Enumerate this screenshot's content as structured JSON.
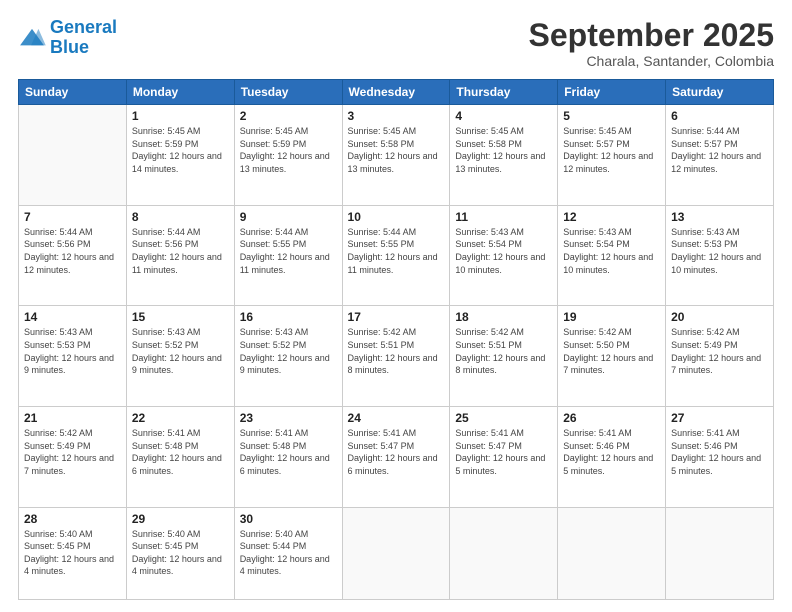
{
  "logo": {
    "line1": "General",
    "line2": "Blue"
  },
  "title": "September 2025",
  "subtitle": "Charala, Santander, Colombia",
  "days_of_week": [
    "Sunday",
    "Monday",
    "Tuesday",
    "Wednesday",
    "Thursday",
    "Friday",
    "Saturday"
  ],
  "weeks": [
    [
      {
        "num": "",
        "info": ""
      },
      {
        "num": "1",
        "info": "Sunrise: 5:45 AM\nSunset: 5:59 PM\nDaylight: 12 hours\nand 14 minutes."
      },
      {
        "num": "2",
        "info": "Sunrise: 5:45 AM\nSunset: 5:59 PM\nDaylight: 12 hours\nand 13 minutes."
      },
      {
        "num": "3",
        "info": "Sunrise: 5:45 AM\nSunset: 5:58 PM\nDaylight: 12 hours\nand 13 minutes."
      },
      {
        "num": "4",
        "info": "Sunrise: 5:45 AM\nSunset: 5:58 PM\nDaylight: 12 hours\nand 13 minutes."
      },
      {
        "num": "5",
        "info": "Sunrise: 5:45 AM\nSunset: 5:57 PM\nDaylight: 12 hours\nand 12 minutes."
      },
      {
        "num": "6",
        "info": "Sunrise: 5:44 AM\nSunset: 5:57 PM\nDaylight: 12 hours\nand 12 minutes."
      }
    ],
    [
      {
        "num": "7",
        "info": "Sunrise: 5:44 AM\nSunset: 5:56 PM\nDaylight: 12 hours\nand 12 minutes."
      },
      {
        "num": "8",
        "info": "Sunrise: 5:44 AM\nSunset: 5:56 PM\nDaylight: 12 hours\nand 11 minutes."
      },
      {
        "num": "9",
        "info": "Sunrise: 5:44 AM\nSunset: 5:55 PM\nDaylight: 12 hours\nand 11 minutes."
      },
      {
        "num": "10",
        "info": "Sunrise: 5:44 AM\nSunset: 5:55 PM\nDaylight: 12 hours\nand 11 minutes."
      },
      {
        "num": "11",
        "info": "Sunrise: 5:43 AM\nSunset: 5:54 PM\nDaylight: 12 hours\nand 10 minutes."
      },
      {
        "num": "12",
        "info": "Sunrise: 5:43 AM\nSunset: 5:54 PM\nDaylight: 12 hours\nand 10 minutes."
      },
      {
        "num": "13",
        "info": "Sunrise: 5:43 AM\nSunset: 5:53 PM\nDaylight: 12 hours\nand 10 minutes."
      }
    ],
    [
      {
        "num": "14",
        "info": "Sunrise: 5:43 AM\nSunset: 5:53 PM\nDaylight: 12 hours\nand 9 minutes."
      },
      {
        "num": "15",
        "info": "Sunrise: 5:43 AM\nSunset: 5:52 PM\nDaylight: 12 hours\nand 9 minutes."
      },
      {
        "num": "16",
        "info": "Sunrise: 5:43 AM\nSunset: 5:52 PM\nDaylight: 12 hours\nand 9 minutes."
      },
      {
        "num": "17",
        "info": "Sunrise: 5:42 AM\nSunset: 5:51 PM\nDaylight: 12 hours\nand 8 minutes."
      },
      {
        "num": "18",
        "info": "Sunrise: 5:42 AM\nSunset: 5:51 PM\nDaylight: 12 hours\nand 8 minutes."
      },
      {
        "num": "19",
        "info": "Sunrise: 5:42 AM\nSunset: 5:50 PM\nDaylight: 12 hours\nand 7 minutes."
      },
      {
        "num": "20",
        "info": "Sunrise: 5:42 AM\nSunset: 5:49 PM\nDaylight: 12 hours\nand 7 minutes."
      }
    ],
    [
      {
        "num": "21",
        "info": "Sunrise: 5:42 AM\nSunset: 5:49 PM\nDaylight: 12 hours\nand 7 minutes."
      },
      {
        "num": "22",
        "info": "Sunrise: 5:41 AM\nSunset: 5:48 PM\nDaylight: 12 hours\nand 6 minutes."
      },
      {
        "num": "23",
        "info": "Sunrise: 5:41 AM\nSunset: 5:48 PM\nDaylight: 12 hours\nand 6 minutes."
      },
      {
        "num": "24",
        "info": "Sunrise: 5:41 AM\nSunset: 5:47 PM\nDaylight: 12 hours\nand 6 minutes."
      },
      {
        "num": "25",
        "info": "Sunrise: 5:41 AM\nSunset: 5:47 PM\nDaylight: 12 hours\nand 5 minutes."
      },
      {
        "num": "26",
        "info": "Sunrise: 5:41 AM\nSunset: 5:46 PM\nDaylight: 12 hours\nand 5 minutes."
      },
      {
        "num": "27",
        "info": "Sunrise: 5:41 AM\nSunset: 5:46 PM\nDaylight: 12 hours\nand 5 minutes."
      }
    ],
    [
      {
        "num": "28",
        "info": "Sunrise: 5:40 AM\nSunset: 5:45 PM\nDaylight: 12 hours\nand 4 minutes."
      },
      {
        "num": "29",
        "info": "Sunrise: 5:40 AM\nSunset: 5:45 PM\nDaylight: 12 hours\nand 4 minutes."
      },
      {
        "num": "30",
        "info": "Sunrise: 5:40 AM\nSunset: 5:44 PM\nDaylight: 12 hours\nand 4 minutes."
      },
      {
        "num": "",
        "info": ""
      },
      {
        "num": "",
        "info": ""
      },
      {
        "num": "",
        "info": ""
      },
      {
        "num": "",
        "info": ""
      }
    ]
  ]
}
